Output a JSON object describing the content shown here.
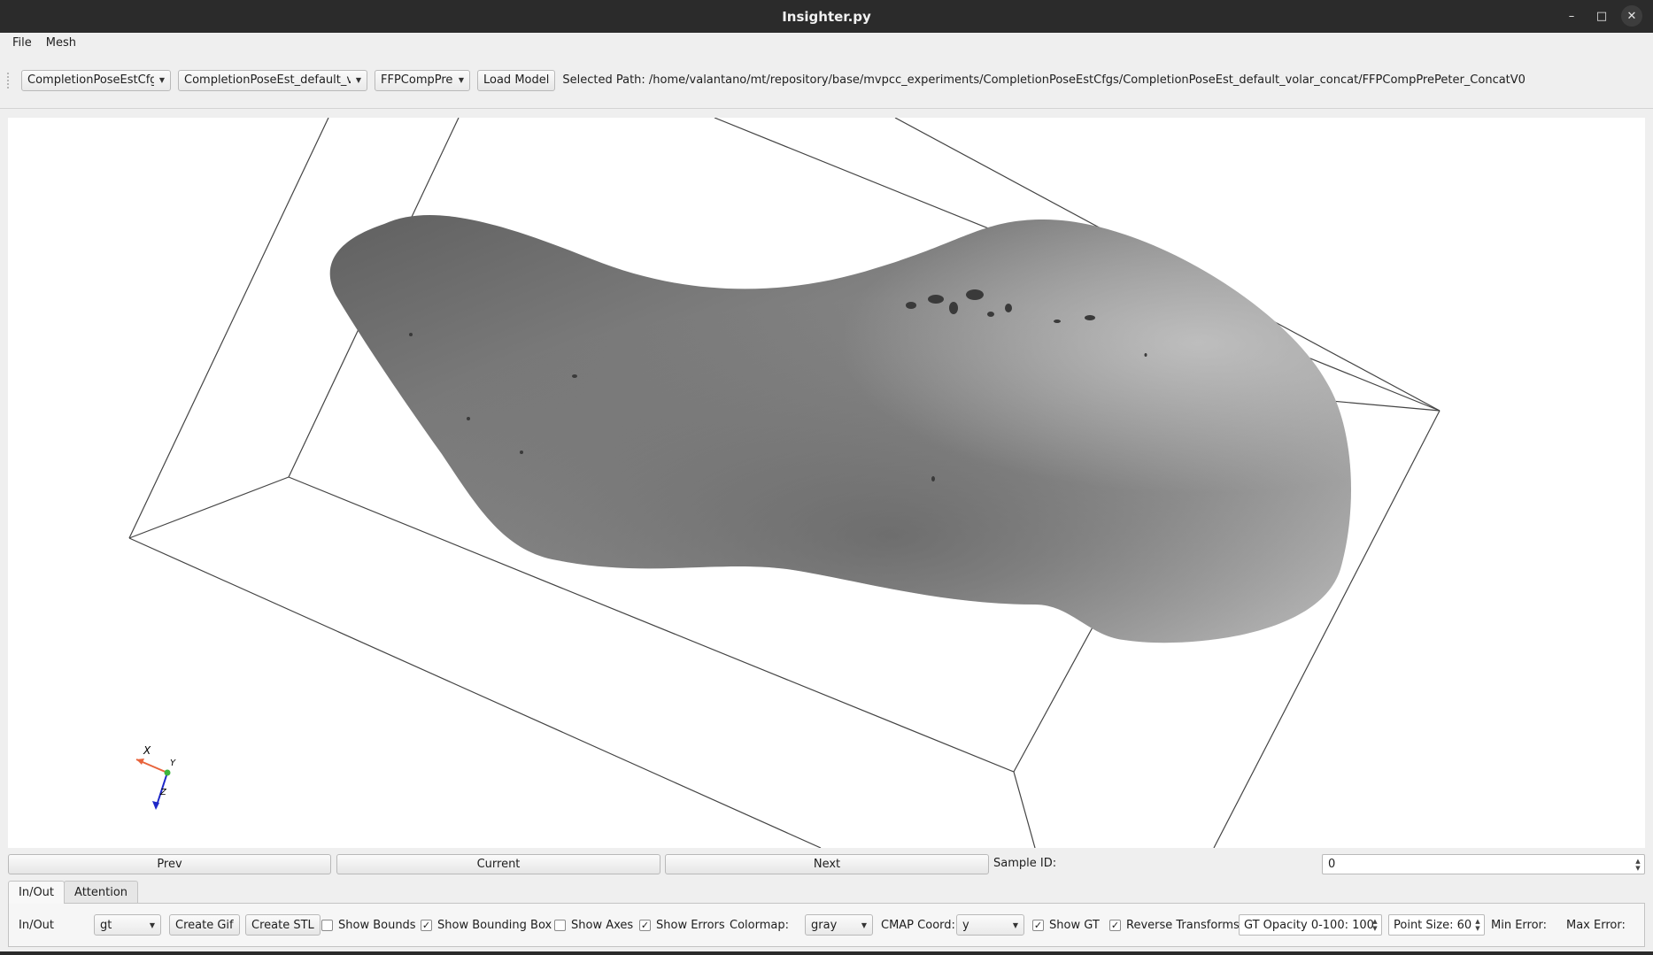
{
  "window": {
    "title": "Insighter.py",
    "controls": {
      "minimize": "–",
      "maximize": "□",
      "close": "✕"
    }
  },
  "menu": [
    "File",
    "Mesh"
  ],
  "toolbar": {
    "config_combo": "CompletionPoseEstCfgs",
    "experiment_combo": "CompletionPoseEst_default_volar_concat",
    "model_combo": "FFPCompPreP",
    "load_button": "Load Model",
    "selected_path_label": "Selected Path: /home/valantano/mt/repository/base/mvpcc_experiments/CompletionPoseEstCfgs/CompletionPoseEst_default_volar_concat/FFPCompPrePeter_ConcatV0"
  },
  "viewport": {
    "axes": {
      "x": "X",
      "y": "Y",
      "z": "Z"
    },
    "axis_colors": {
      "x": "#e8643c",
      "y": "#3cb43c",
      "z": "#1e28c8"
    }
  },
  "nav": {
    "prev": "Prev",
    "current": "Current",
    "next": "Next",
    "sample_label": "Sample ID:",
    "sample_value": "0"
  },
  "tabs": [
    {
      "label": "In/Out",
      "active": true
    },
    {
      "label": "Attention",
      "active": false
    }
  ],
  "panel": {
    "label": "In/Out",
    "mode_combo": "gt",
    "create_gif": "Create Gif",
    "create_stl": "Create STL",
    "show_bounds": {
      "label": "Show Bounds",
      "checked": false
    },
    "show_bbox": {
      "label": "Show Bounding Box",
      "checked": true
    },
    "show_axes": {
      "label": "Show Axes",
      "checked": false
    },
    "show_errors": {
      "label": "Show Errors",
      "checked": true
    },
    "colormap_label": "Colormap:",
    "colormap_value": "gray",
    "cmap_coord_label": "CMAP Coord:",
    "cmap_coord_value": "y",
    "show_gt": {
      "label": "Show GT",
      "checked": true
    },
    "reverse_transforms": {
      "label": "Reverse Transforms",
      "checked": true
    },
    "gt_opacity": "GT Opacity 0-100: 100",
    "point_size": "Point Size: 60",
    "min_error_label": "Min Error:",
    "max_error_label": "Max Error:"
  },
  "check_glyph": "✓"
}
